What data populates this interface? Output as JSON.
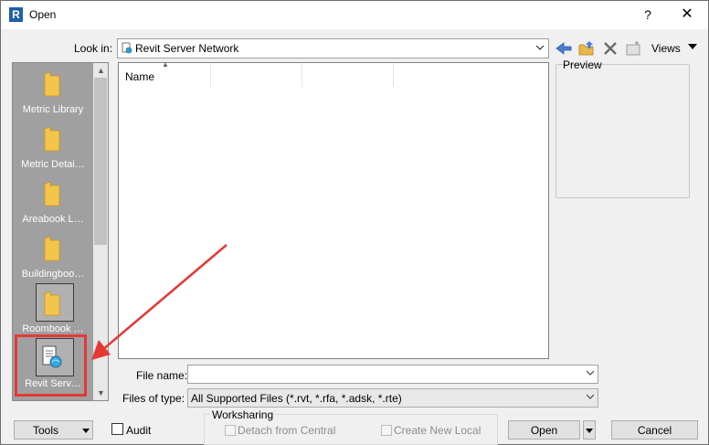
{
  "window": {
    "title": "Open",
    "app_icon_letter": "R",
    "help_glyph": "?",
    "close_glyph": "✕"
  },
  "toolbar": {
    "look_in_label": "Look in:",
    "look_in_value": "Revit Server Network",
    "views_label": "Views",
    "icons": [
      "back-icon",
      "up-folder-icon",
      "delete-icon",
      "new-folder-icon"
    ]
  },
  "sidebar": {
    "items": [
      {
        "label": "Metric Library",
        "icon": "folder-icon"
      },
      {
        "label": "Metric Detai…",
        "icon": "folder-icon"
      },
      {
        "label": "Areabook L…",
        "icon": "folder-icon"
      },
      {
        "label": "Buildingboo…",
        "icon": "folder-icon"
      },
      {
        "label": "Roombook …",
        "icon": "folder-icon"
      },
      {
        "label": "Revit Serv…",
        "icon": "revit-server-icon"
      }
    ]
  },
  "file_list": {
    "columns": [
      "Name",
      "",
      ""
    ]
  },
  "preview": {
    "label": "Preview"
  },
  "file_name": {
    "label": "File name:",
    "value": ""
  },
  "file_type": {
    "label": "Files of type:",
    "value": "All Supported Files  (*.rvt, *.rfa, *.adsk, *.rte)"
  },
  "bottom": {
    "tools_label": "Tools",
    "audit_label": "Audit",
    "worksharing_label": "Worksharing",
    "detach_label": "Detach from Central",
    "create_local_label": "Create New Local",
    "open_label": "Open",
    "cancel_label": "Cancel"
  },
  "annotation": {
    "color": "#e53935"
  }
}
